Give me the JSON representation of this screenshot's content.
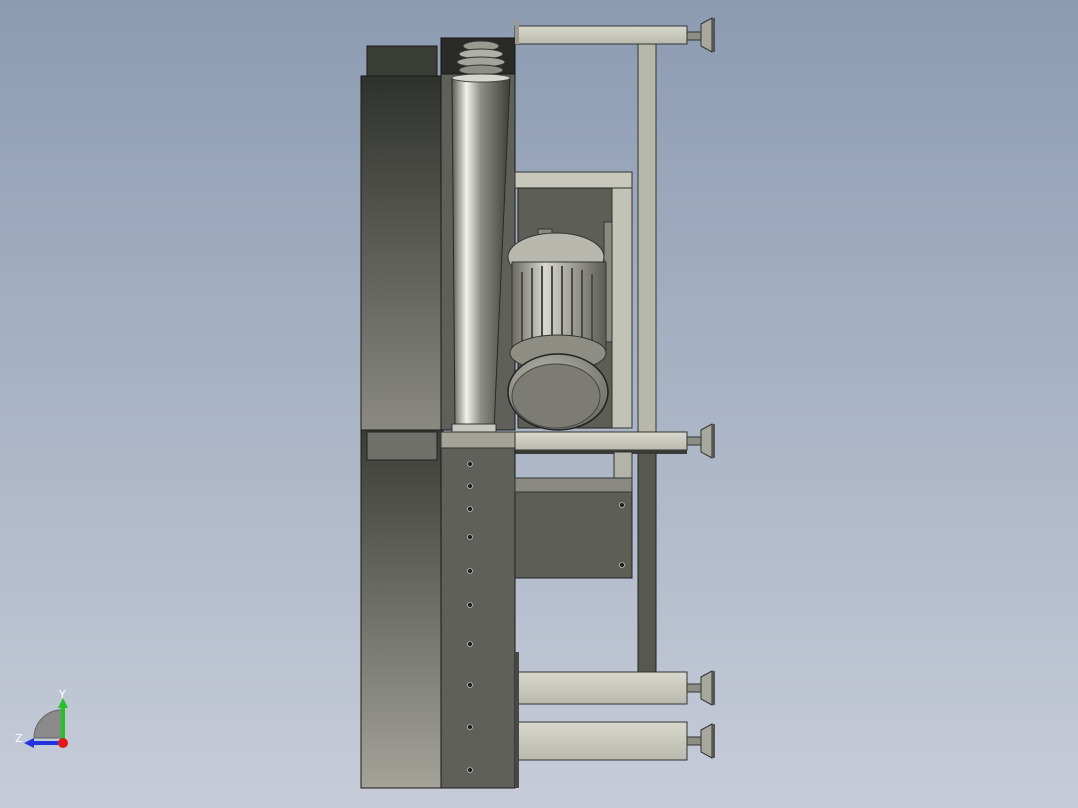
{
  "view": {
    "background_top": "#8c9bb2",
    "background_bottom": "#c7ccd8"
  },
  "triad": {
    "x_label": "",
    "y_label": "Y",
    "z_label": "Z",
    "y_color": "#22c22a",
    "z_color": "#2233dd",
    "x_color": "#e01818"
  }
}
